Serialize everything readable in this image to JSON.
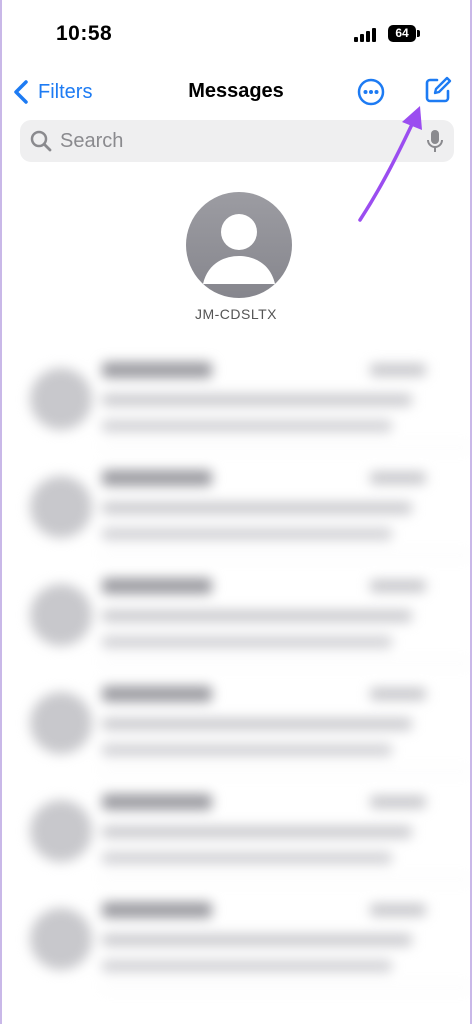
{
  "status_bar": {
    "time": "10:58",
    "battery_level": "64"
  },
  "nav": {
    "back_label": "Filters",
    "title": "Messages"
  },
  "search": {
    "placeholder": "Search"
  },
  "contact": {
    "name": "JM-CDSLTX"
  },
  "icons": {
    "back": "chevron-left-icon",
    "more": "ellipsis-circle-icon",
    "compose": "compose-icon",
    "search": "search-icon",
    "mic": "microphone-icon",
    "avatar": "person-icon",
    "arrow": "annotation-arrow-icon"
  },
  "colors": {
    "accent": "#1d7bf3",
    "annotation_arrow": "#9b4df0"
  },
  "conversation_rows_visible": 7
}
